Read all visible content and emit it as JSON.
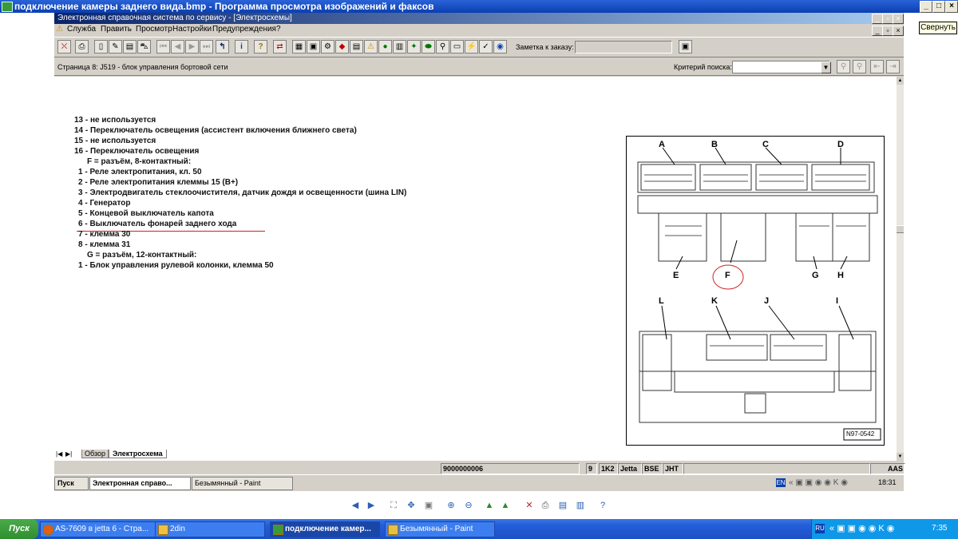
{
  "outer_window": {
    "title": "подключение камеры заднего вида.bmp - Программа просмотра изображений и факсов",
    "minimize_tooltip": "Свернуть"
  },
  "app": {
    "title": "Электронная справочная система по сервису - [Электросхемы]",
    "menu": [
      "Служба",
      "Править",
      "Просмотр",
      "Настройки",
      "Предупреждения",
      "?"
    ],
    "order_note_label": "Заметка к заказу:",
    "page_title": "Страница 8: J519 - блок управления бортовой сети",
    "search_label": "Критерий поиска:",
    "search_value": ""
  },
  "document": {
    "lines": [
      "13 - не используется",
      "14 - Переключатель освещения (ассистент включения ближнего света)",
      "15 - не используется",
      "16 - Переключатель освещения",
      "F = разъём, 8-контактный:",
      "1 - Реле электропитания, кл. 50",
      "2 - Реле электропитания клеммы 15 (B+)",
      "3 - Электродвигатель стеклоочистителя, датчик дождя и освещенности (шина LIN)",
      "4 - Генератор",
      "5 - Концевой выключатель капота",
      "6 - Выключатель фонарей заднего хода",
      "7 - клемма 30",
      "8 - клемма 31",
      "G = разъём, 12-контактный:",
      "1 - Блок управления рулевой колонки, клемма 50"
    ],
    "highlight_color": "#d02020"
  },
  "diagram": {
    "top_labels": [
      "A",
      "B",
      "C",
      "D"
    ],
    "mid_labels": [
      "E",
      "F",
      "G",
      "H"
    ],
    "bottom_labels": [
      "L",
      "K",
      "J",
      "I"
    ],
    "ref_code": "N97-0542"
  },
  "tabs": [
    "Обзор",
    "Электросхема"
  ],
  "status": {
    "code": "9000000006",
    "f1": "9",
    "f2": "1K2",
    "f3": "Jetta",
    "f4": "BSE",
    "f5": "JHT",
    "f6": "AAS"
  },
  "inner_taskbar": {
    "start": "Пуск",
    "items": [
      "Электронная справо...",
      "Безымянный - Paint"
    ],
    "lang": "EN",
    "time": "18:31"
  },
  "taskbar": {
    "start": "Пуск",
    "items": [
      "AS-7609 в jetta 6 - Стра...",
      "2din",
      "подключение камер...",
      "Безымянный - Paint"
    ],
    "lang": "RU",
    "time": "7:35"
  }
}
